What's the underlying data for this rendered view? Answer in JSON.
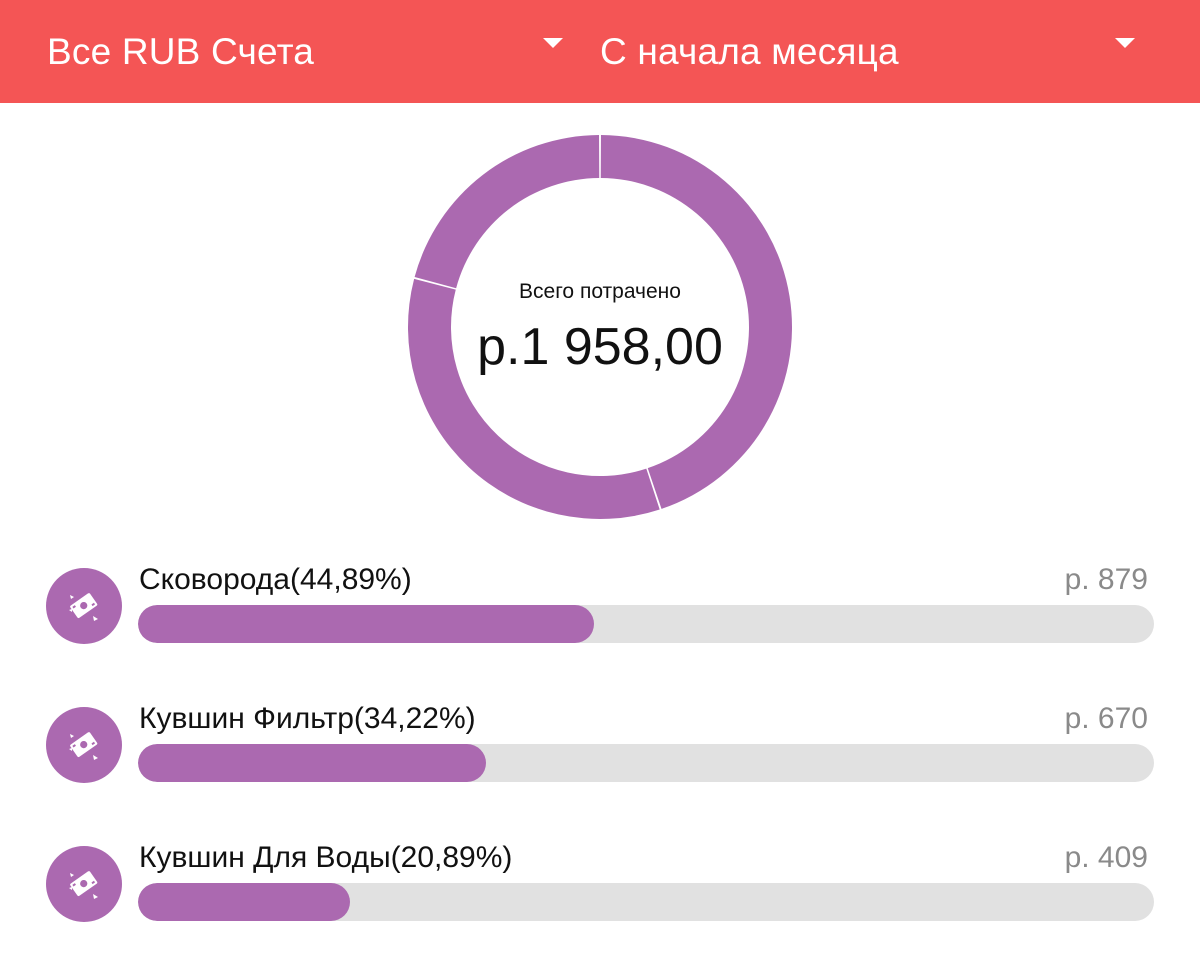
{
  "header": {
    "accounts_label": "Все RUB Счета",
    "period_label": "С начала месяца",
    "caret_icon": "dropdown-arrow-icon"
  },
  "summary": {
    "caption": "Всего потрачено",
    "total": "р.1 958,00"
  },
  "colors": {
    "header_bg": "#f45555",
    "accent": "#ab69b0",
    "track": "#e1e1e1",
    "amount_text": "#8a8a8a"
  },
  "chart_data": {
    "type": "pie",
    "categories": [
      "Сковорода",
      "Кувшин Фильтр",
      "Кувшин Для Воды"
    ],
    "values": [
      44.89,
      34.22,
      20.89
    ]
  },
  "categories": [
    {
      "label": "Сковорода(44,89%)",
      "amount": "р. 879",
      "share": 0.4489,
      "icon": "money-icon"
    },
    {
      "label": "Кувшин Фильтр(34,22%)",
      "amount": "р. 670",
      "share": 0.3422,
      "icon": "money-icon"
    },
    {
      "label": "Кувшин Для Воды(20,89%)",
      "amount": "р. 409",
      "share": 0.2089,
      "icon": "money-icon"
    }
  ]
}
